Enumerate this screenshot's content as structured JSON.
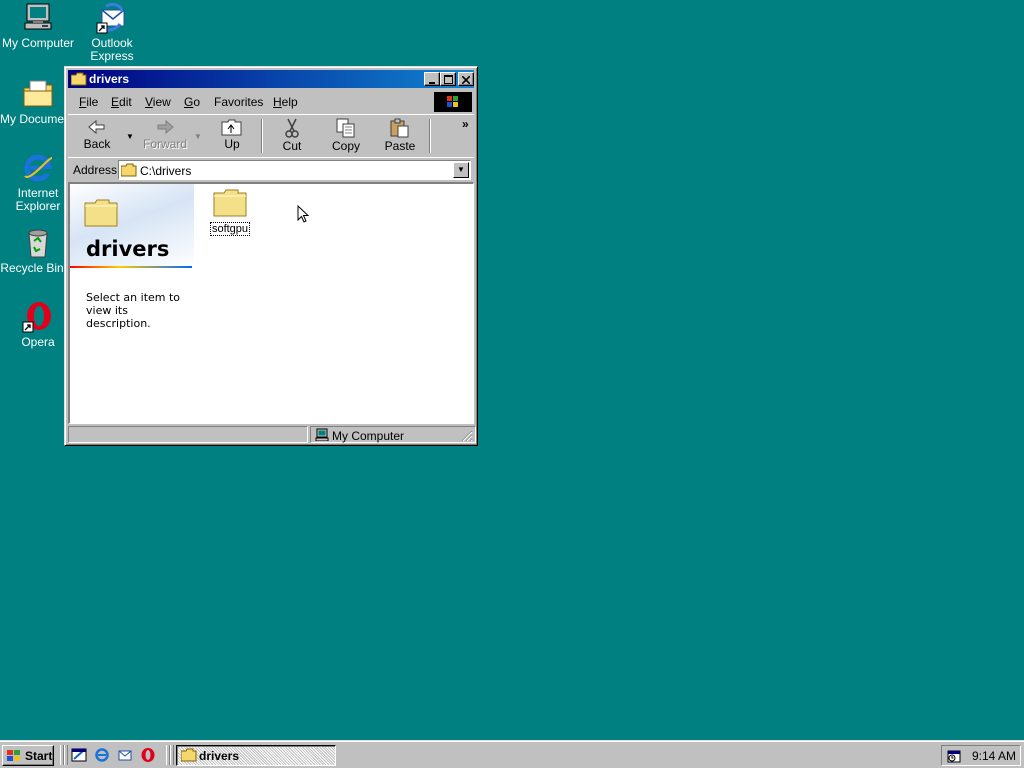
{
  "desktop": {
    "background": "#008080",
    "icons": [
      {
        "label": "My Computer",
        "icon": "my-computer-icon"
      },
      {
        "label": "Outlook Express",
        "icon": "outlook-express-icon"
      },
      {
        "label": "My Documents",
        "icon": "my-documents-icon"
      },
      {
        "label": "Internet Explorer",
        "icon": "internet-explorer-icon"
      },
      {
        "label": "Recycle Bin",
        "icon": "recycle-bin-icon"
      },
      {
        "label": "Opera",
        "icon": "opera-icon"
      }
    ]
  },
  "window": {
    "title": "drivers",
    "icon": "folder-icon",
    "menu": [
      {
        "label": "File",
        "accel": "F",
        "rest": "ile"
      },
      {
        "label": "Edit",
        "accel": "E",
        "rest": "dit"
      },
      {
        "label": "View",
        "accel": "V",
        "rest": "iew"
      },
      {
        "label": "Go",
        "accel": "G",
        "rest": "o"
      },
      {
        "label": "Favorites",
        "accel": "F",
        "rest": "avorites",
        "accel_index": 0
      },
      {
        "label": "Help",
        "accel": "H",
        "rest": "elp"
      }
    ],
    "toolbar": {
      "back": "Back",
      "forward": "Forward",
      "up": "Up",
      "cut": "Cut",
      "copy": "Copy",
      "paste": "Paste",
      "more": "»"
    },
    "address": {
      "label": "Address",
      "value": "C:\\drivers"
    },
    "panel": {
      "title": "drivers",
      "description": "Select an item to view its description."
    },
    "items": [
      {
        "name": "softgpu",
        "icon": "folder-icon",
        "selected": true
      }
    ],
    "status": {
      "location": "My Computer"
    }
  },
  "taskbar": {
    "start_label": "Start",
    "quick_launch": [
      "show-desktop-icon",
      "internet-explorer-icon",
      "outlook-express-icon",
      "opera-icon"
    ],
    "tasks": [
      {
        "label": "drivers",
        "active": true
      }
    ],
    "clock": "9:14 AM"
  }
}
